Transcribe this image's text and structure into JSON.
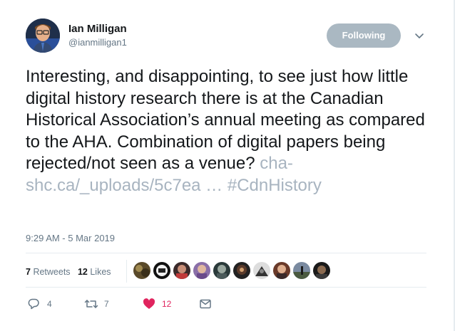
{
  "author": {
    "name": "Ian Milligan",
    "handle": "@ianmilligan1",
    "follow_label": "Following"
  },
  "tweet": {
    "text": "Interesting, and disappointing, to see just how little digital history research there is at the Canadian Historical Association’s annual meeting as compared to the AHA. Combination of digital papers being rejected/not seen as a venue? ",
    "link": "cha-shc.ca/_uploads/5c7ea … ",
    "hashtag": "#CdnHistory",
    "timestamp": "9:29 AM - 5 Mar 2019"
  },
  "stats": {
    "retweets_count": "7",
    "retweets_label": "Retweets",
    "likes_count": "12",
    "likes_label": "Likes"
  },
  "actions": {
    "reply_count": "4",
    "retweet_count": "7",
    "like_count": "12"
  },
  "colors": {
    "link": "#a8b4c0",
    "follow_button": "#aab8c2",
    "like": "#e0245e",
    "secondary_text": "#657786"
  },
  "icons": [
    "chevron-down-icon",
    "reply-icon",
    "retweet-icon",
    "heart-icon",
    "message-icon"
  ]
}
